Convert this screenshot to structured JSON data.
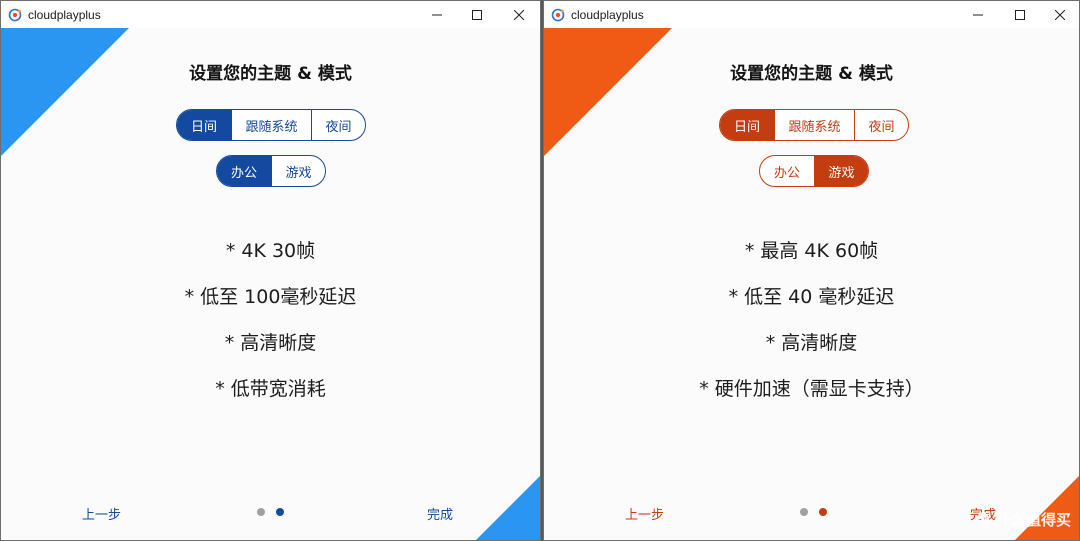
{
  "colors": {
    "blue_accent": "#1449a0",
    "blue_corner": "#2b96f2",
    "orange_accent": "#c43d10",
    "orange_corner": "#ef5a14",
    "dot_inactive": "#a0a0a0"
  },
  "windows": [
    {
      "id": "left",
      "app_title": "cloudplayplus",
      "heading": "设置您的主题 & 模式",
      "theme_options": [
        "日间",
        "跟随系统",
        "夜间"
      ],
      "theme_selected": 0,
      "mode_options": [
        "办公",
        "游戏"
      ],
      "mode_selected": 0,
      "features": [
        "* 4K 30帧",
        "* 低至 100毫秒延迟",
        "* 高清晰度",
        "* 低带宽消耗"
      ],
      "back_label": "上一步",
      "finish_label": "完成",
      "page_index": 2,
      "page_count": 2
    },
    {
      "id": "right",
      "app_title": "cloudplayplus",
      "heading": "设置您的主题 & 模式",
      "theme_options": [
        "日间",
        "跟随系统",
        "夜间"
      ],
      "theme_selected": 0,
      "mode_options": [
        "办公",
        "游戏"
      ],
      "mode_selected": 1,
      "features": [
        "* 最高 4K 60帧",
        "* 低至 40 毫秒延迟",
        "* 高清晰度",
        "* 硬件加速（需显卡支持）"
      ],
      "back_label": "上一步",
      "finish_label": "完成",
      "page_index": 2,
      "page_count": 2,
      "watermark": "值 什么值得买"
    }
  ]
}
